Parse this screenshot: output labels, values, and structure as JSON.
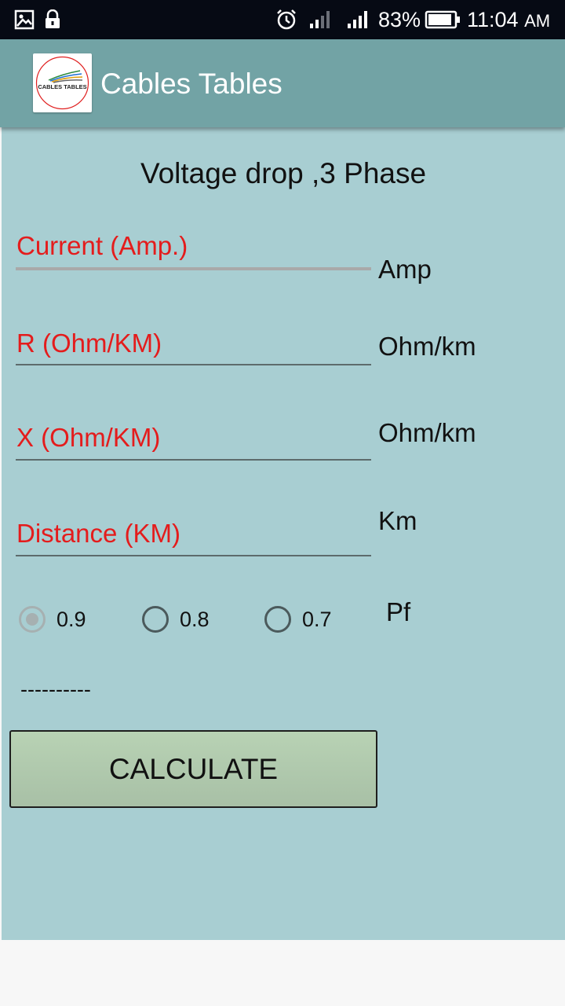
{
  "status_bar": {
    "battery_percent": "83%",
    "time": "11:04",
    "ampm": "AM",
    "icons": [
      "gallery-icon",
      "lock-icon",
      "alarm-icon",
      "signal-weak-icon",
      "signal-strong-icon",
      "battery-icon"
    ]
  },
  "app_bar": {
    "title": "Cables Tables",
    "logo_text": "CABLES TABLES",
    "accent_color": "#72a3a5"
  },
  "screen": {
    "title": "Voltage drop ,3 Phase",
    "background_color": "#a8ced2",
    "hint_color": "#e41c1c"
  },
  "fields": [
    {
      "hint": "Current (Amp.)",
      "unit": "Amp"
    },
    {
      "hint": "R (Ohm/KM)",
      "unit": "Ohm/km"
    },
    {
      "hint": "X (Ohm/KM)",
      "unit": "Ohm/km"
    },
    {
      "hint": "Distance (KM)",
      "unit": "Km"
    }
  ],
  "power_factor": {
    "label": "Pf",
    "options": [
      "0.9",
      "0.8",
      "0.7"
    ],
    "selected": "0.9"
  },
  "result_text": "----------",
  "calculate_label": "CALCULATE"
}
